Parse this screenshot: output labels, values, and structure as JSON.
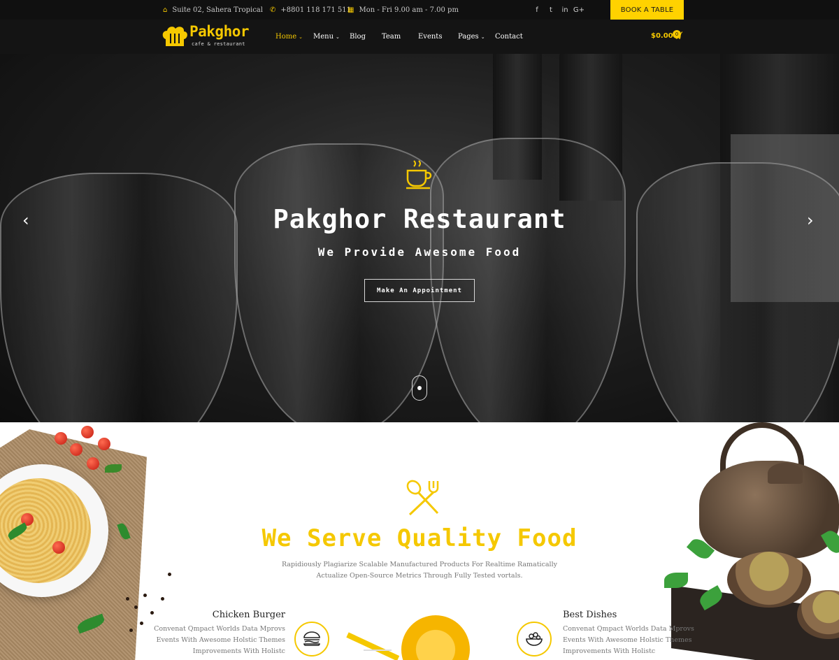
{
  "topbar": {
    "address": "Suite 02, Sahera Tropical",
    "phone": "+8801 118 171 511",
    "hours": "Mon - Fri 9.00 am - 7.00 pm",
    "social": [
      "f",
      "t",
      "in",
      "G+"
    ],
    "book_label": "BOOK A TABLE"
  },
  "nav": {
    "brand": "Pakghor",
    "tagline": "cafe & restaurant",
    "items": [
      {
        "label": "Home"
      },
      {
        "label": "Menu"
      },
      {
        "label": "Blog"
      },
      {
        "label": "Team"
      },
      {
        "label": "Events"
      },
      {
        "label": "Pages"
      },
      {
        "label": "Contact"
      }
    ],
    "cart_total": "$0.00",
    "cart_count": "0"
  },
  "hero": {
    "title": "Pakghor Restaurant",
    "subtitle": "We Provide Awesome Food",
    "button": "Make An Appointment"
  },
  "services": {
    "title": "We Serve Quality Food",
    "description": "Rapidiously Plagiarize Scalable Manufactured Products For Realtime Ramatically Actualize Open-Source Metrics Through Fully Tested vortals.",
    "features": [
      {
        "title": "Chicken Burger",
        "lines": [
          "Convenat Qmpact Worlds Data Mprovs",
          "Events With Awesome Holstic Themes",
          "Improvements With Holistc"
        ]
      },
      {
        "title": "Best Dishes",
        "lines": [
          "Convenat Qmpact Worlds Data Mprovs",
          "Events With Awesome Holstic Themes",
          "Improvements With Holistc"
        ]
      }
    ]
  },
  "colors": {
    "accent": "#f5c800",
    "dark": "#141414"
  }
}
